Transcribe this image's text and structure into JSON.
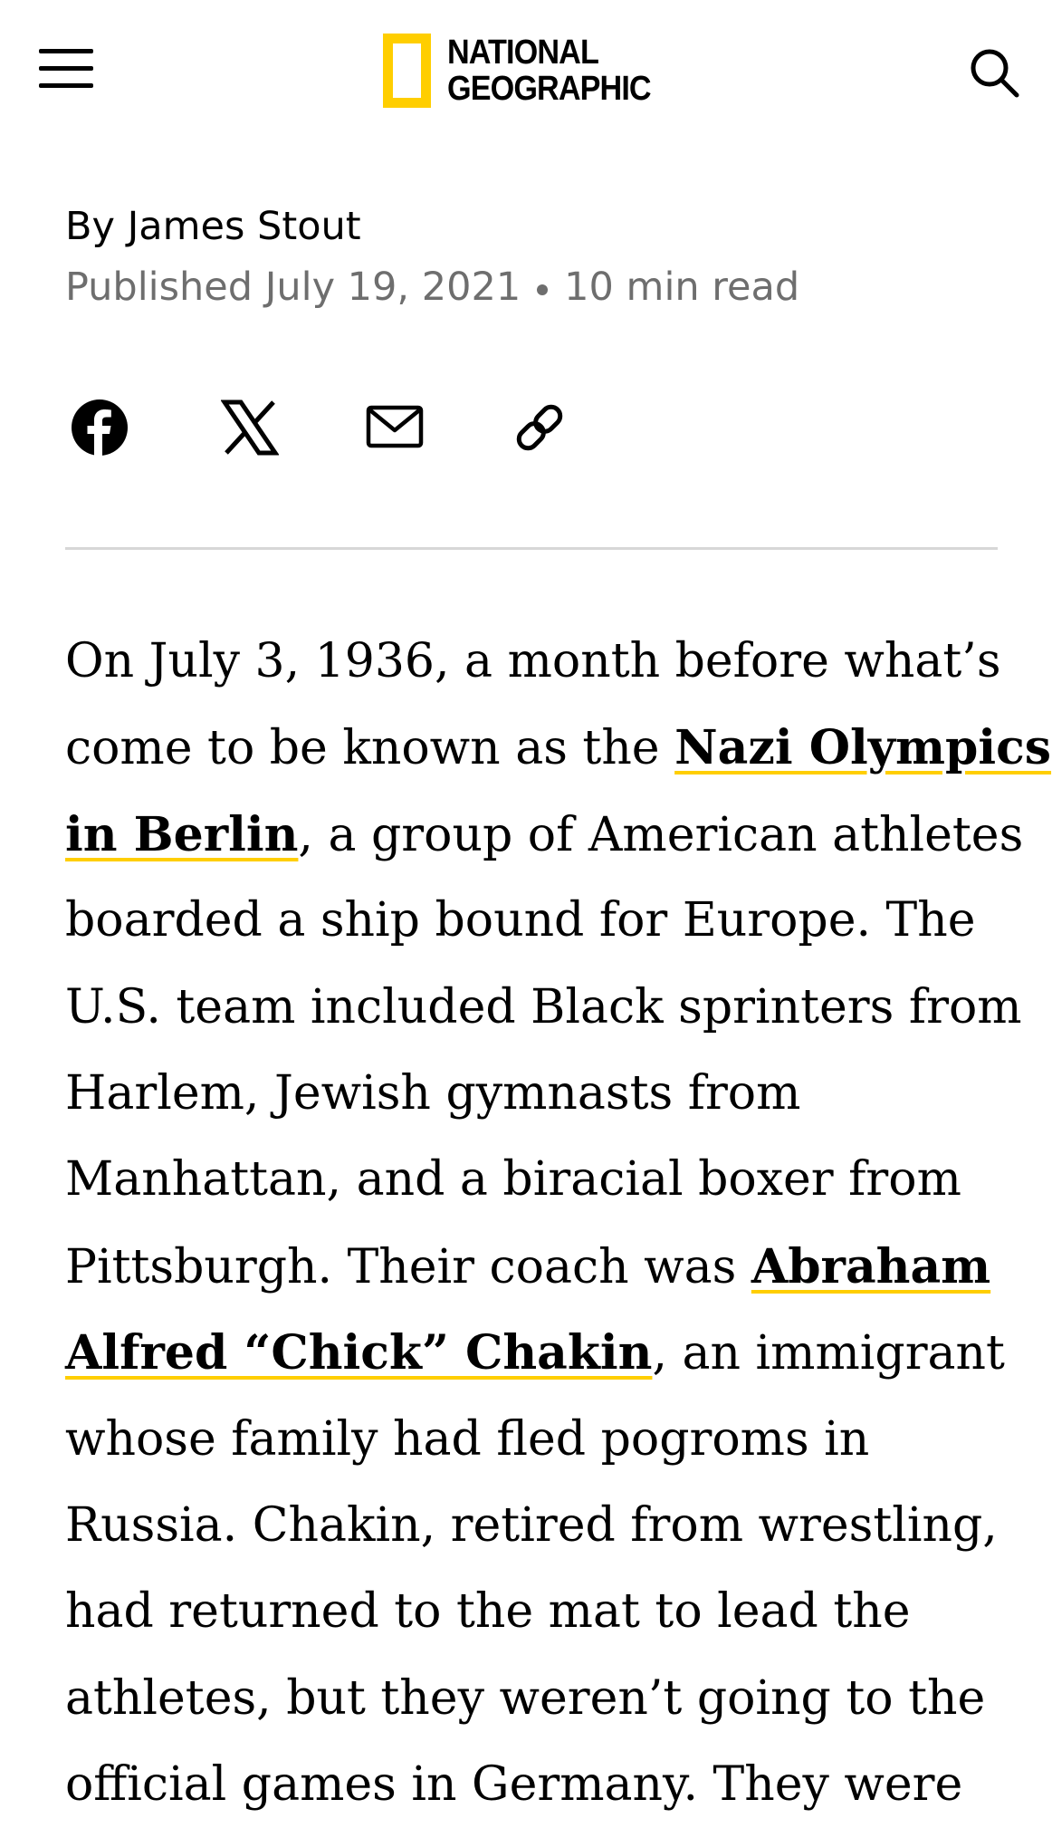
{
  "header": {
    "menu_icon": "hamburger-menu-icon",
    "logo": {
      "line1": "NATIONAL",
      "line2": "GEOGRAPHIC",
      "border_color": "#ffce00"
    },
    "search_icon": "search-icon"
  },
  "article_meta": {
    "byline": "By James Stout",
    "published": "Published July 19, 2021",
    "read_time": "10 min read"
  },
  "share": {
    "items": [
      {
        "name": "facebook",
        "icon": "facebook-icon"
      },
      {
        "name": "x",
        "icon": "x-icon"
      },
      {
        "name": "email",
        "icon": "email-icon"
      },
      {
        "name": "copy-link",
        "icon": "link-icon"
      }
    ]
  },
  "colors": {
    "accent": "#ffce00",
    "meta_gray": "#6e6e6e",
    "divider": "#d7d7d7"
  },
  "article": {
    "l1": "On July 3, 1936, a month before what’s",
    "l2_pre": "come to be known as the ",
    "link1_part1": "Nazi Olympics",
    "link1_part2": "in Berlin",
    "l3_post": ", a group of American athletes",
    "l4": "boarded a ship bound for Europe. The",
    "l5": "U.S. team included Black sprinters from",
    "l6": "Harlem, Jewish gymnasts from",
    "l7": "Manhattan, and a biracial boxer from",
    "l8_pre": "Pittsburgh. Their coach was ",
    "link2_part1": "Abraham",
    "link2_part2": "Alfred “Chick” Chakin",
    "l9_post": ", an immigrant",
    "l10": "whose family had fled pogroms in",
    "l11": "Russia. Chakin, retired from wrestling,",
    "l12": "had returned to the mat to lead the",
    "l13": "athletes, but they weren’t going to the",
    "l14": "official games in Germany. They were"
  }
}
